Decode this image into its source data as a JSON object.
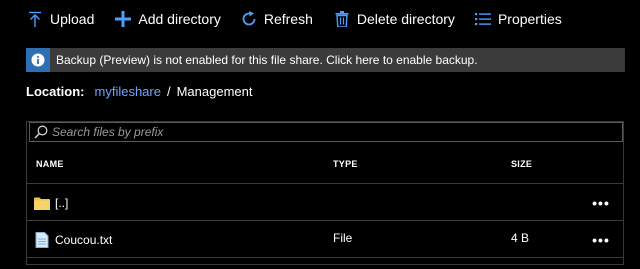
{
  "toolbar": {
    "upload_label": "Upload",
    "add_directory_label": "Add directory",
    "refresh_label": "Refresh",
    "delete_directory_label": "Delete directory",
    "properties_label": "Properties"
  },
  "banner": {
    "text": "Backup (Preview) is not enabled for this file share. Click here to enable backup.",
    "icon": "info-icon"
  },
  "location": {
    "label": "Location:",
    "share": "myfileshare",
    "separator": "/",
    "folder": "Management"
  },
  "search": {
    "placeholder": "Search files by prefix"
  },
  "table": {
    "columns": [
      "NAME",
      "TYPE",
      "SIZE"
    ],
    "rows": [
      {
        "name": "[..]",
        "type": "",
        "size": "",
        "icon": "folder-icon",
        "more": "•••"
      },
      {
        "name": "Coucou.txt",
        "type": "File",
        "size": "4 B",
        "icon": "document-icon",
        "more": "•••"
      }
    ]
  },
  "colors": {
    "accent": "#4d9dff",
    "banner_bg": "#3b3b3b",
    "info_bg": "#2d6fb2",
    "link": "#6aa6ff",
    "folder": "#f2c04b"
  }
}
